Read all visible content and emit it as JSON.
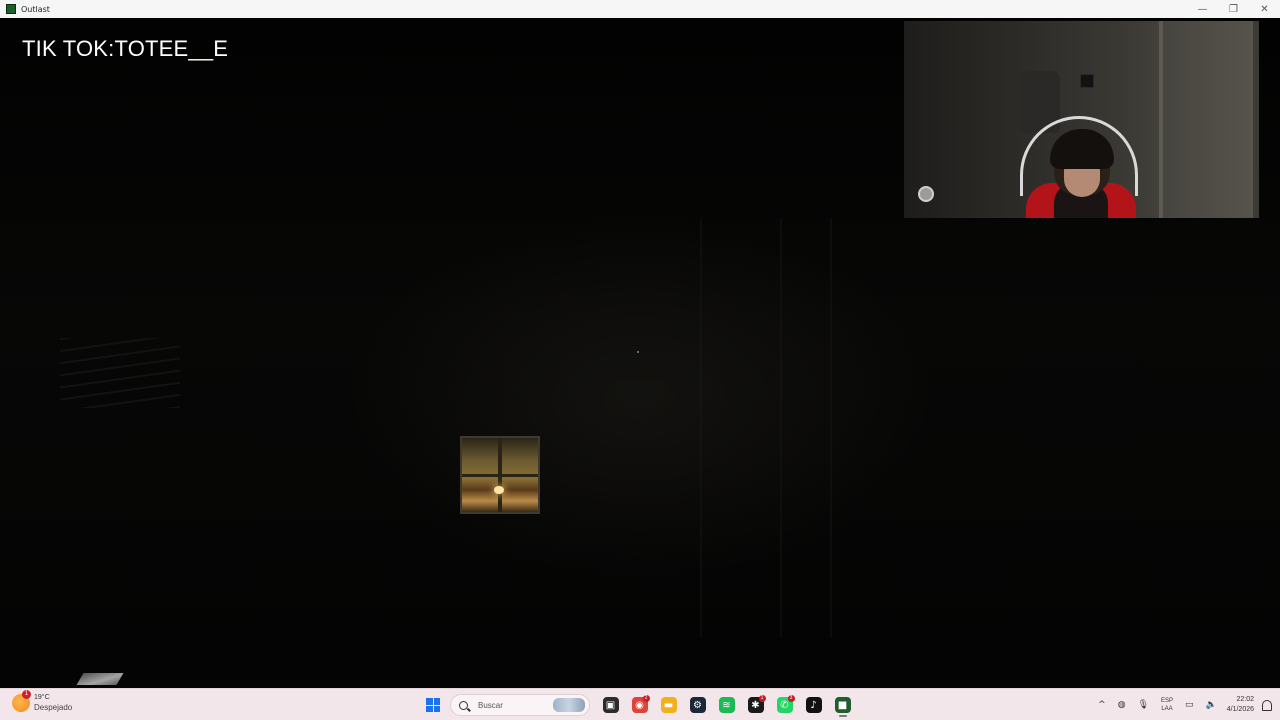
{
  "window": {
    "title": "Outlast",
    "minimize_glyph": "—",
    "maximize_glyph": "❐",
    "close_glyph": "✕"
  },
  "overlay": {
    "text": "TIK TOK:TOTEE__E"
  },
  "taskbar": {
    "weather": {
      "temp": "19°C",
      "desc": "Despejado",
      "badge": "1",
      "icon": "weather-sun-icon"
    },
    "search_placeholder": "Buscar",
    "apps": [
      {
        "name": "task-view",
        "glyph": "▣",
        "color": "#2b2b2b"
      },
      {
        "name": "chrome",
        "glyph": "◉",
        "color": "#db4437",
        "badge": "2"
      },
      {
        "name": "file-explorer",
        "glyph": "▬",
        "color": "#f2b01e"
      },
      {
        "name": "steam",
        "glyph": "⚙",
        "color": "#1b2838"
      },
      {
        "name": "spotify",
        "glyph": "≋",
        "color": "#1db954"
      },
      {
        "name": "app-red-black",
        "glyph": "✱",
        "color": "#1a1a1a",
        "badge": "1"
      },
      {
        "name": "whatsapp",
        "glyph": "✆",
        "color": "#25d366",
        "badge": "3"
      },
      {
        "name": "tiktok",
        "glyph": "♪",
        "color": "#111111"
      },
      {
        "name": "outlast",
        "glyph": "■",
        "color": "#1f5d2b",
        "active": true
      }
    ],
    "tray": {
      "chevron": "^",
      "lang_line1": "ESP",
      "lang_line2": "LAA",
      "time": "22:02",
      "date": "4/1/2026"
    }
  },
  "colors": {
    "taskbar_bg": "#f3e6ea",
    "start_blue": "#1a73e8"
  }
}
